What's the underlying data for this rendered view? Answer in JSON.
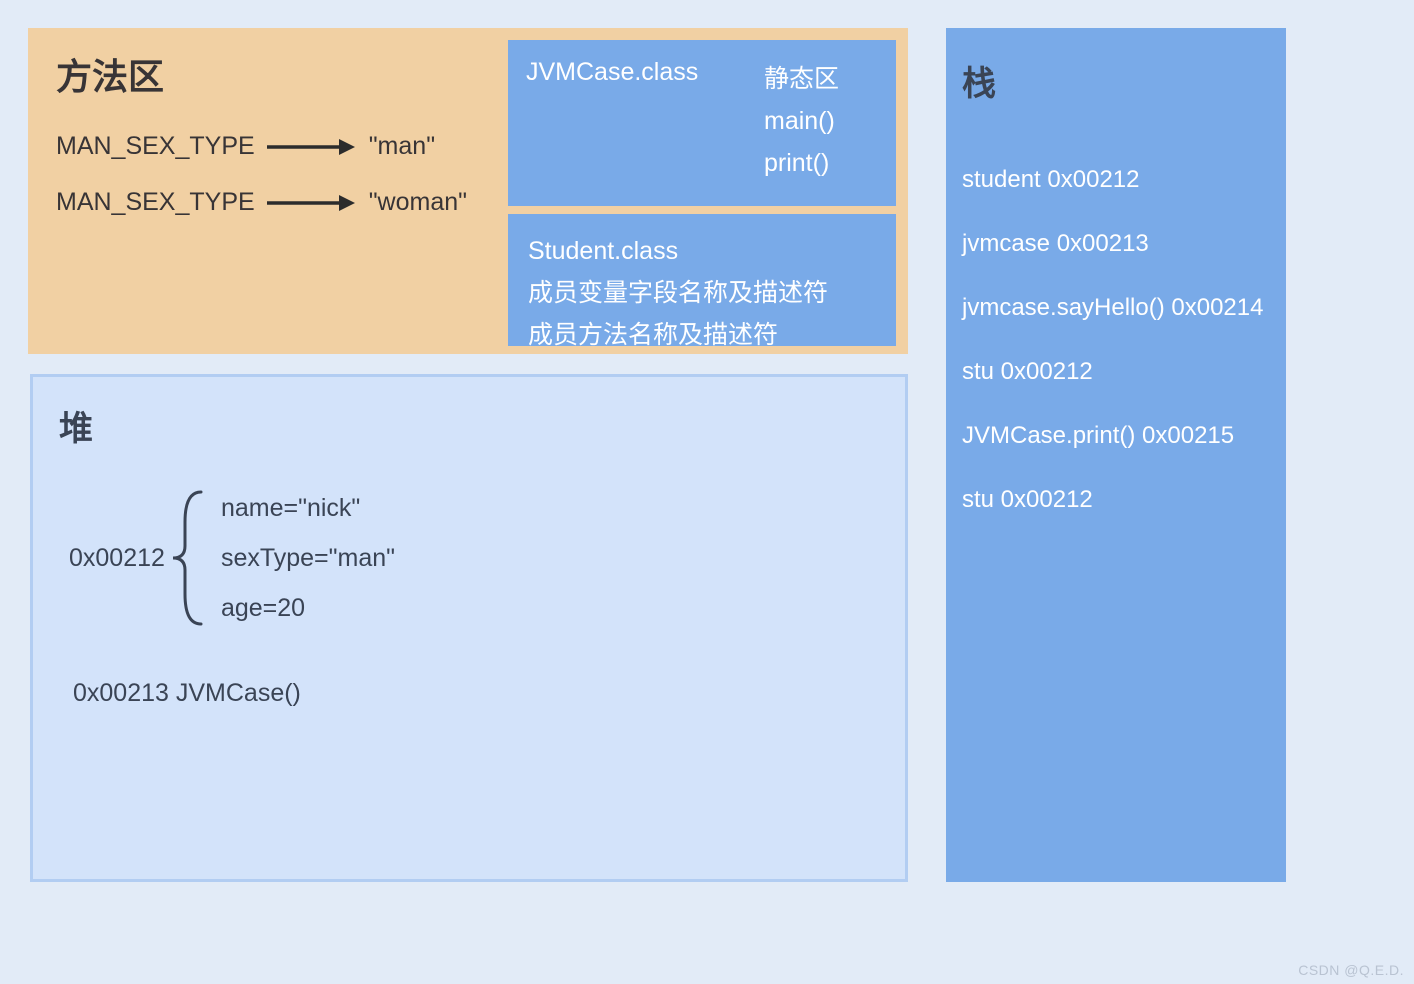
{
  "methodArea": {
    "title": "方法区",
    "constants": [
      {
        "key": "MAN_SEX_TYPE",
        "value": "\"man\""
      },
      {
        "key": "MAN_SEX_TYPE",
        "value": "\"woman\""
      }
    ],
    "jvmcase": {
      "className": "JVMCase.class",
      "staticLabel": "静态区",
      "methods": [
        "main()",
        "print()"
      ]
    },
    "student": {
      "className": "Student.class",
      "line1": "成员变量字段名称及描述符",
      "line2": "成员方法名称及描述符"
    }
  },
  "heap": {
    "title": "堆",
    "object1": {
      "address": "0x00212",
      "fields": [
        "name=\"nick\"",
        "sexType=\"man\"",
        "age=20"
      ]
    },
    "object2": "0x00213   JVMCase()"
  },
  "stack": {
    "title": "栈",
    "items": [
      "student   0x00212",
      "jvmcase   0x00213",
      "jvmcase.sayHello() 0x00214",
      "stu   0x00212",
      "JVMCase.print() 0x00215",
      "stu   0x00212"
    ]
  },
  "watermark": "CSDN @Q.E.D."
}
